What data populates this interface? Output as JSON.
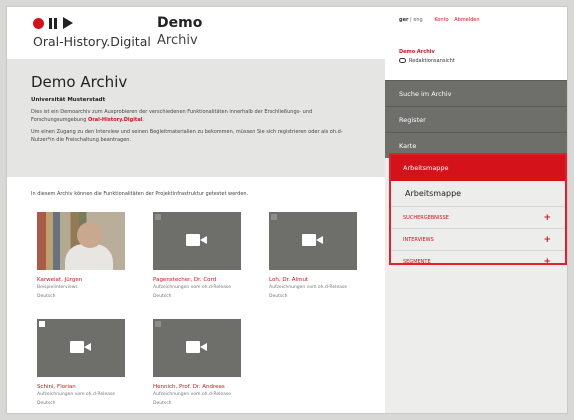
{
  "header": {
    "logo_text": "Oral-History.Digital",
    "archive_name": "Demo",
    "archive_sub": "Archiv"
  },
  "intro": {
    "title": "Demo Archiv",
    "university": "Universität Musterstadt",
    "para1_a": "Dies ist ein Demoarchiv zum Ausprobieren der verschiedenen Funktionalitäten innerhalb der Erschließungs- und Forschungsumgebung ",
    "para1_brand": "Oral-History.Digital",
    "para1_b": ".",
    "para2": "Um einen Zugang zu den Interview und seinen Begleitmaterialien zu bekommen, müssen Sie sich registrieren oder als oh.d-Nutzer*in die Freischaltung beantragen."
  },
  "content": {
    "lead": "In diesem Archiv können die Funktionalitäten der Projektinfrastruktur getestet werden."
  },
  "cards": [
    {
      "name": "Karweiat, Jürgen",
      "meta1": "Beispielinterviews",
      "meta2": "Deutsch"
    },
    {
      "name": "Pagenstecher, Dr. Cord",
      "meta1": "Aufzeichnungen vom oh.d-Release",
      "meta2": "Deutsch"
    },
    {
      "name": "Loh, Dr. Almut",
      "meta1": "Aufzeichnungen vom oh.d-Release",
      "meta2": "Deutsch"
    },
    {
      "name": "Schini, Florian",
      "meta1": "Aufzeichnungen vom oh.d-Release",
      "meta2": "Deutsch"
    },
    {
      "name": "Hennich, Prof. Dr. Andreas",
      "meta1": "Aufzeichnungen vom oh.d-Release",
      "meta2": "Deutsch"
    }
  ],
  "sidebar": {
    "lang_active": "ger",
    "lang_other": "eng",
    "konto": "Konto",
    "abmelden": "Abmelden",
    "archive_label": "Demo Archiv",
    "redaktion": "Redaktionsansicht",
    "nav": [
      "Suche im Archiv",
      "Register",
      "Karte"
    ],
    "mappe_tab": "Arbeitsmappe",
    "mappe_title": "Arbeitsmappe",
    "rows": [
      "SUCHERGEBNISSE",
      "INTERVIEWS",
      "SEGMENTE"
    ]
  },
  "colors": {
    "accent": "#d4121a",
    "nav_bg": "#6e6e6a",
    "intro_bg": "#e5e5e3"
  }
}
